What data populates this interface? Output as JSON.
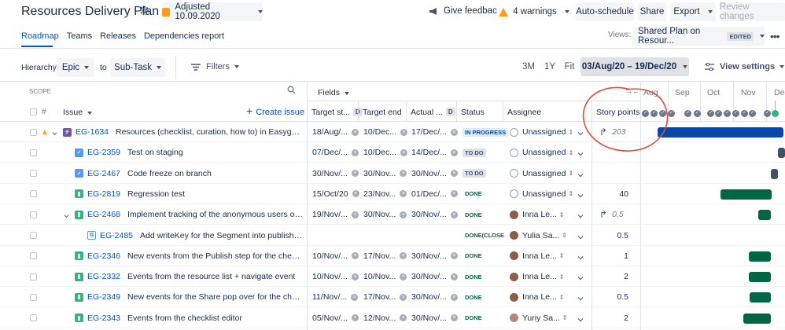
{
  "header": {
    "title": "Resources Delivery Plan",
    "adjusted_label": "Adjusted 10.09.2020",
    "give_feedback": "Give feedback",
    "warnings": "4 warnings",
    "auto_schedule": "Auto-schedule",
    "share": "Share",
    "export": "Export",
    "review_changes": "Review changes"
  },
  "tabs": [
    "Roadmap",
    "Teams",
    "Releases",
    "Dependencies report"
  ],
  "views": {
    "label": "Views:",
    "selected": "Shared Plan on Resour...",
    "edited_badge": "EDITED"
  },
  "toolbar": {
    "hierarchy_label": "Hierarchy:",
    "from_level": "Epic",
    "to_label": "to",
    "to_level": "Sub-Task",
    "filters": "Filters",
    "range_options": [
      "3M",
      "1Y",
      "Fit"
    ],
    "date_range": "03/Aug/20 – 19/Dec/20",
    "view_settings": "View settings"
  },
  "table_header": {
    "scope": "SCOPE",
    "fields": "Fields",
    "hash": "#",
    "issue": "Issue",
    "create_issue": "Create issue",
    "target_start": "Target st...",
    "target_end": "Target end",
    "actual": "Actual ...",
    "status": "Status",
    "assignee": "Assignee",
    "story_points": "Story points",
    "d_badge": "D"
  },
  "timeline": {
    "months": [
      "Aug",
      "Sep",
      "Oct",
      "Nov",
      "Dec"
    ],
    "colors": {
      "blue_bar": "#0747a6",
      "green_bar": "#006644",
      "dark_bar": "#42526e",
      "annotation": "#e5493a"
    }
  },
  "rows": [
    {
      "key": "EG-1634",
      "summary": "Resources (checklist, curation, how to) in Easygenerator",
      "type": "epic",
      "target_start": "18/Aug/...",
      "target_end": "10/Dec...",
      "actual": "17/Dec/...",
      "status": "IN PROGRESS",
      "assignee": "Unassigned",
      "story_points": "203",
      "sp_rollup": true
    },
    {
      "key": "EG-2359",
      "summary": "Test on staging",
      "type": "task",
      "target_start": "07/Dec/...",
      "target_end": "10/Dec...",
      "actual": "14/Dec/...",
      "status": "TO DO",
      "assignee": "Unassigned",
      "story_points": ""
    },
    {
      "key": "EG-2467",
      "summary": "Code freeze on branch",
      "type": "task",
      "target_start": "30/Nov/...",
      "target_end": "30/Nov...",
      "actual": "30/Nov/...",
      "status": "TO DO",
      "assignee": "Unassigned",
      "story_points": ""
    },
    {
      "key": "EG-2819",
      "summary": "Regression test",
      "type": "story",
      "target_start": "15/Oct/20",
      "target_end": "23/Nov...",
      "actual": "01/Dec/...",
      "status": "DONE",
      "assignee": "Unassigned",
      "story_points": "40"
    },
    {
      "key": "EG-2468",
      "summary": "Implement tracking of the anonymous users on learn ...",
      "type": "story",
      "target_start": "19/Nov/...",
      "target_end": "30/Nov...",
      "actual": "30/Nov/...",
      "status": "DONE",
      "assignee": "Inna Le...",
      "story_points": "0.5",
      "sp_rollup": true
    },
    {
      "key": "EG-2485",
      "summary": "Add writeKey for the Segment into publishSetting...",
      "type": "subtask",
      "target_start": "",
      "target_end": "",
      "actual": "",
      "status": "DONE(CLOSE",
      "assignee": "Yulia Sa...",
      "story_points": "0.5"
    },
    {
      "key": "EG-2346",
      "summary": "New events from the Publish step for the checklist",
      "type": "story",
      "target_start": "10/Nov/...",
      "target_end": "17/Nov...",
      "actual": "30/Nov/...",
      "status": "DONE",
      "assignee": "Inna Le...",
      "story_points": "1"
    },
    {
      "key": "EG-2332",
      "summary": "Events from the resource list + navigate event",
      "type": "story",
      "target_start": "10/Nov/...",
      "target_end": "10/Nov...",
      "actual": "30/Nov/...",
      "status": "DONE",
      "assignee": "Inna Le...",
      "story_points": "2"
    },
    {
      "key": "EG-2349",
      "summary": "New events for the Share pop over for the checklist",
      "type": "story",
      "target_start": "11/Nov/...",
      "target_end": "17/Nov...",
      "actual": "30/Nov/...",
      "status": "DONE",
      "assignee": "Inna Le...",
      "story_points": "0.5"
    },
    {
      "key": "EG-2343",
      "summary": "Events from the checklist editor",
      "type": "story",
      "target_start": "05/Nov/...",
      "target_end": "12/Nov...",
      "actual": "30/Nov/...",
      "status": "DONE",
      "assignee": "Yuriy Sa...",
      "story_points": "2"
    }
  ]
}
